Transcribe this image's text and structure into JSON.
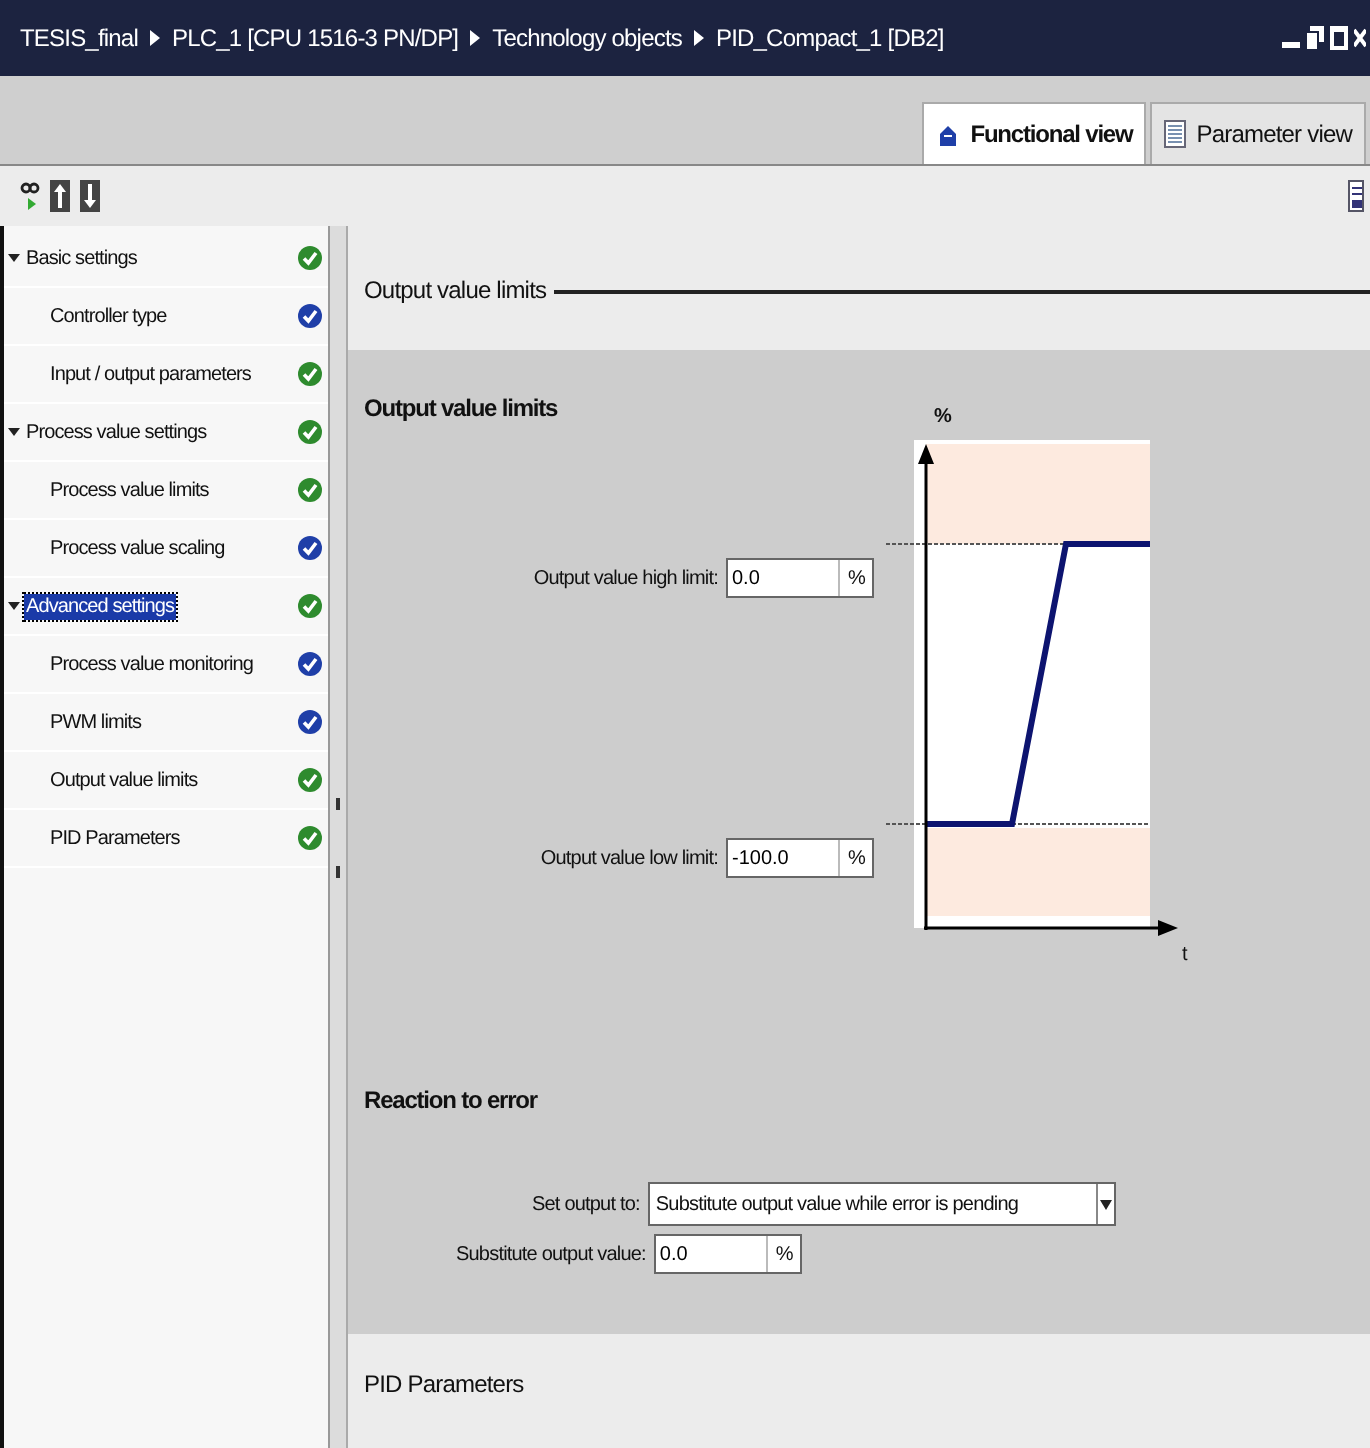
{
  "window": {
    "breadcrumb": [
      "TESIS_final",
      "PLC_1 [CPU 1516-3 PN/DP]",
      "Technology objects",
      "PID_Compact_1 [DB2]"
    ]
  },
  "tabs": [
    {
      "label": "Functional view",
      "selected": true,
      "kind": "functional"
    },
    {
      "label": "Parameter view",
      "selected": false,
      "kind": "parameter"
    }
  ],
  "sidebar": {
    "items": [
      {
        "label": "Basic settings",
        "selected": false,
        "expanded": true,
        "color": "#2e8b2e",
        "children": [
          {
            "label": "Controller type",
            "selected": false,
            "color": "#1f3fa8"
          },
          {
            "label": "Input / output parameters",
            "selected": false,
            "color": "#2e8b2e"
          }
        ]
      },
      {
        "label": "Process value settings",
        "selected": false,
        "expanded": true,
        "color": "#2e8b2e",
        "children": [
          {
            "label": "Process value limits",
            "selected": false,
            "color": "#2e8b2e"
          },
          {
            "label": "Process value scaling",
            "selected": false,
            "color": "#1f3fa8"
          }
        ]
      },
      {
        "label": "Advanced settings",
        "selected": true,
        "expanded": true,
        "color": "#2e8b2e",
        "children": [
          {
            "label": "Process value monitoring",
            "selected": false,
            "color": "#1f3fa8"
          },
          {
            "label": "PWM limits",
            "selected": false,
            "color": "#1f3fa8"
          },
          {
            "label": "Output value limits",
            "selected": false,
            "color": "#2e8b2e"
          },
          {
            "label": "PID Parameters",
            "selected": false,
            "color": "#2e8b2e"
          }
        ]
      }
    ]
  },
  "section": {
    "title": "Output value limits",
    "panel_title": "Output value limits",
    "limits": [
      {
        "label": "Output value high limit:",
        "value": "0.0",
        "unit": "%"
      },
      {
        "label": "Output value low limit:",
        "value": "-100.0",
        "unit": "%"
      }
    ],
    "diagram": {
      "y_label": "%",
      "x_label": "t"
    },
    "reaction": {
      "title": "Reaction to error",
      "set_output": {
        "label": "Set output to:",
        "value": "Substitute output value while error is pending"
      },
      "substitute": {
        "label": "Substitute output value:",
        "value": "0.0",
        "unit": "%"
      }
    }
  },
  "next_section": {
    "title": "PID Parameters"
  }
}
